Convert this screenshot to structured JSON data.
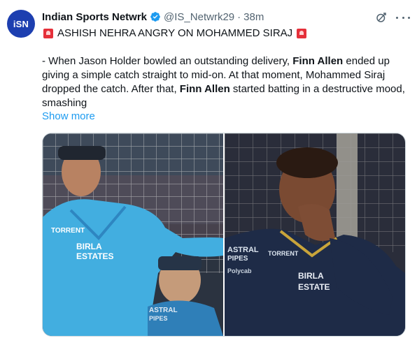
{
  "tweet": {
    "avatar_text": "iSN",
    "display_name": "Indian Sports Netwrk",
    "handle": "@IS_Netwrk29",
    "separator": "·",
    "time": "38m",
    "headline": "ASHISH NEHRA ANGRY ON MOHAMMED SIRAJ",
    "body_parts": [
      "- When Jason Holder bowled an outstanding delivery, ",
      "Finn Allen",
      " ended up giving a simple catch straight to mid-on. At that moment, Mohammed Siraj dropped the catch. After that, ",
      "Finn Allen",
      " started batting in a destructive mood, smashing"
    ],
    "show_more": "Show more"
  },
  "media": {
    "left_photo": {
      "texts": [
        "TORRENT",
        "BIRLA",
        "ESTATES",
        "ASTRAL",
        "PIPES"
      ]
    },
    "right_photo": {
      "texts": [
        "ASTRAL",
        "PIPES",
        "TORRENT",
        "BIRLA",
        "ESTATE",
        "Polycab"
      ]
    }
  },
  "colors": {
    "accent": "#1d9bf0",
    "verified": "#1d9bf0",
    "avatar_bg": "#1d3fb0",
    "siren": "#e5303a"
  },
  "icons": [
    "verified-badge-icon",
    "grok-icon",
    "more-options-icon",
    "siren-icon"
  ]
}
